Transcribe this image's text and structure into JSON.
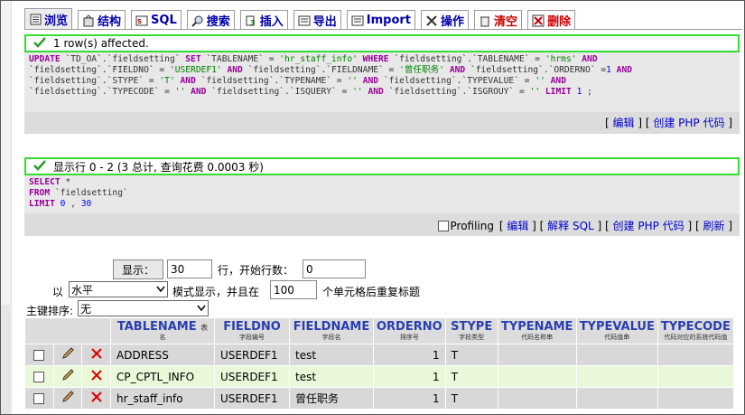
{
  "tabs": [
    {
      "label": "浏览",
      "icon": "browse-icon",
      "active": true
    },
    {
      "label": "结构",
      "icon": "structure-icon"
    },
    {
      "label": "SQL",
      "icon": "sql-icon"
    },
    {
      "label": "搜索",
      "icon": "search-icon"
    },
    {
      "label": "插入",
      "icon": "insert-icon"
    },
    {
      "label": "导出",
      "icon": "export-icon"
    },
    {
      "label": "Import",
      "icon": "import-icon"
    },
    {
      "label": "操作",
      "icon": "operations-icon"
    },
    {
      "label": "清空",
      "icon": "empty-icon",
      "danger": true
    },
    {
      "label": "删除",
      "icon": "drop-icon",
      "danger": true
    }
  ],
  "msg1": {
    "text": "1 row(s) affected.",
    "sql_lines": [
      "UPDATE `TD_OA`.`fieldsetting` SET `TABLENAME` = 'hr_staff_info' WHERE `fieldsetting`.`TABLENAME` = 'hrms' AND",
      "`fieldsetting`.`FIELDNO` = 'USERDEF1' AND `fieldsetting`.`FIELDNAME` = '曾任职务' AND `fieldsetting`.`ORDERNO` =1 AND",
      "`fieldsetting`.`STYPE` = 'T' AND `fieldsetting`.`TYPENAME` = '' AND `fieldsetting`.`TYPEVALUE` = '' AND",
      "`fieldsetting`.`TYPECODE` = '' AND `fieldsetting`.`ISQUERY` = '' AND `fieldsetting`.`ISGROUY` = '' LIMIT 1 ;"
    ],
    "edit_link": "编辑",
    "php_link": "创建 PHP 代码"
  },
  "msg2": {
    "text": "显示行 0 - 2 (3 总计, 查询花费 0.0003 秒)",
    "sql_lines": [
      "SELECT *",
      "FROM `fieldsetting`",
      "LIMIT 0 , 30"
    ],
    "profiling_label": "Profiling",
    "edit_link": "编辑",
    "explain_link": "解释 SQL",
    "php_link": "创建 PHP 代码",
    "refresh_link": "刷新"
  },
  "nav": {
    "show_button": "显示：",
    "rows_value": "30",
    "rows_label": "行，开始行数：",
    "start_value": "0",
    "in_label": "以",
    "mode_value": "水平",
    "mode_label": "模式显示，并且在",
    "repeat_value": "100",
    "repeat_label": "个单元格后重复标题",
    "sort_label": "主键排序:",
    "sort_value": "无"
  },
  "columns": [
    {
      "name": "TABLENAME",
      "note": "表",
      "sub": "名"
    },
    {
      "name": "FIELDNO",
      "sub": "字段编号"
    },
    {
      "name": "FIELDNAME",
      "sub": "字段名"
    },
    {
      "name": "ORDERNO",
      "sub": "排序号"
    },
    {
      "name": "STYPE",
      "sub": "字段类型"
    },
    {
      "name": "TYPENAME",
      "sub": "代码名称串"
    },
    {
      "name": "TYPEVALUE",
      "sub": "代码值串"
    },
    {
      "name": "TYPECODE",
      "sub": "代码对应的系统代码值"
    }
  ],
  "rows": [
    {
      "TABLENAME": "ADDRESS",
      "FIELDNO": "USERDEF1",
      "FIELDNAME": "test",
      "ORDERNO": "1",
      "STYPE": "T",
      "TYPENAME": "",
      "TYPEVALUE": "",
      "TYPECODE": ""
    },
    {
      "TABLENAME": "CP_CPTL_INFO",
      "FIELDNO": "USERDEF1",
      "FIELDNAME": "test",
      "ORDERNO": "1",
      "STYPE": "T",
      "TYPENAME": "",
      "TYPEVALUE": "",
      "TYPECODE": ""
    },
    {
      "TABLENAME": "hr_staff_info",
      "FIELDNO": "USERDEF1",
      "FIELDNAME": "曾任职务",
      "ORDERNO": "1",
      "STYPE": "T",
      "TYPENAME": "",
      "TYPEVALUE": "",
      "TYPECODE": ""
    }
  ],
  "colors": {
    "success_border": "#33dd33",
    "header_text": "#2a3fb0",
    "link": "#0000cc",
    "row_alt": "#e9f8d8"
  }
}
